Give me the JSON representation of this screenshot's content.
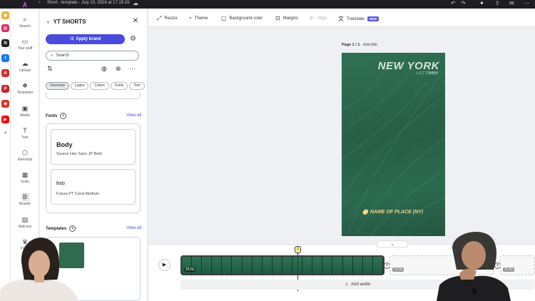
{
  "titlebar": {
    "title": "Short - template - July 10, 2024 at 17.19.15"
  },
  "dock_apps": [
    {
      "name": "chrome",
      "color": "#e8b23a",
      "glyph": "◉"
    },
    {
      "name": "instagram",
      "color": "#d6336c",
      "glyph": "◎"
    },
    {
      "name": "notion",
      "color": "#222222",
      "glyph": "N"
    },
    {
      "name": "facebook",
      "color": "#1877f2",
      "glyph": "f"
    },
    {
      "name": "acrobat",
      "color": "#c9302c",
      "glyph": "A"
    },
    {
      "name": "pinterest",
      "color": "#c8232c",
      "glyph": "P"
    },
    {
      "name": "app-red",
      "color": "#d9342b",
      "glyph": "◆"
    },
    {
      "name": "youtube",
      "color": "#ff0000",
      "glyph": "▶"
    },
    {
      "name": "add",
      "color": "#ffffff",
      "glyph": "+"
    }
  ],
  "rail": [
    {
      "label": "Search",
      "icon": "search-icon",
      "glyph": "⌕"
    },
    {
      "label": "Your stuff",
      "icon": "folder-icon",
      "glyph": "▭"
    },
    {
      "label": "Upload",
      "icon": "upload-icon",
      "glyph": "☁"
    },
    {
      "label": "Templates",
      "icon": "templates-icon",
      "glyph": "❖"
    },
    {
      "label": "Media",
      "icon": "media-icon",
      "glyph": "▣"
    },
    {
      "label": "Text",
      "icon": "text-icon",
      "glyph": "T"
    },
    {
      "label": "Elements",
      "icon": "elements-icon",
      "glyph": "⬠"
    },
    {
      "label": "Grids",
      "icon": "grids-icon",
      "glyph": "▦"
    },
    {
      "label": "Brands",
      "icon": "brands-icon",
      "glyph": "B"
    },
    {
      "label": "Add-ons",
      "icon": "addons-icon",
      "glyph": "▤"
    },
    {
      "label": "Prem",
      "icon": "premium-icon",
      "glyph": "♛"
    }
  ],
  "panel": {
    "title": "YT SHORTS",
    "apply_brand": "Apply brand",
    "search_placeholder": "Search",
    "chips": [
      "Overview",
      "Logos",
      "Colors",
      "Fonts",
      "Tem"
    ],
    "fonts_title": "Fonts",
    "view_all": "View all",
    "font_cards": [
      {
        "sample": "Body",
        "family": "Source Han Sans JP Bold"
      },
      {
        "sample": "Body",
        "family": "Futura PT Cond Medium"
      }
    ],
    "templates_title": "Templates",
    "templates_view_all": "View all"
  },
  "toolbar": {
    "resize": "Resize",
    "theme": "Theme",
    "background_color": "Background color",
    "margins": "Margins",
    "align": "Align",
    "translate": "Translate",
    "new_badge": "NEW"
  },
  "page": {
    "label": "Page 1 / 1",
    "add_title": " - Add title",
    "heading": "NEW YORK",
    "subheading": "ヒロアズ事務所",
    "place": "NAME OF PLACE (NY)"
  },
  "timeline": {
    "clip_duration": "24.8s",
    "ghost1_duration": "12.9s",
    "ghost2_duration": "11.5s",
    "add_audio": "Add audio"
  },
  "colors": {
    "accent": "#4b4bdb",
    "canvas_green": "#2b6a4f",
    "place_gold": "#f0d585"
  }
}
